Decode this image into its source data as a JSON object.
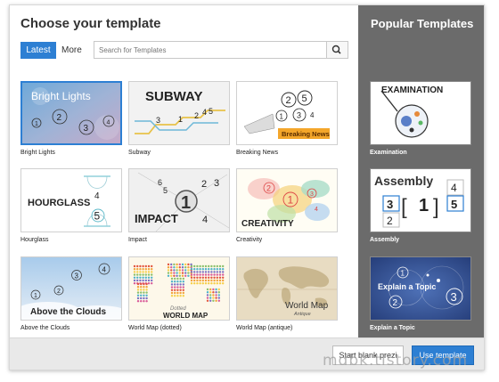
{
  "dialog": {
    "title": "Choose your template",
    "tabs": {
      "latest": "Latest",
      "more": "More"
    },
    "search": {
      "placeholder": "Search for Templates",
      "icon": "search-icon"
    }
  },
  "templates": [
    {
      "caption": "Bright Lights",
      "thumb_text": "Bright Lights",
      "numbers": [
        "1",
        "2",
        "3",
        "4"
      ],
      "selected": true
    },
    {
      "caption": "Subway",
      "thumb_text": "SUBWAY",
      "numbers": [
        "1",
        "2",
        "3",
        "4",
        "5"
      ]
    },
    {
      "caption": "Breaking News",
      "thumb_text": "Breaking News",
      "numbers": [
        "1",
        "2",
        "3",
        "4",
        "5"
      ]
    },
    {
      "caption": "Hourglass",
      "thumb_text": "HOURGLASS",
      "numbers": [
        "4",
        "5"
      ]
    },
    {
      "caption": "Impact",
      "thumb_text": "IMPACT",
      "numbers": [
        "1",
        "2",
        "3",
        "4",
        "5",
        "6"
      ]
    },
    {
      "caption": "Creativity",
      "thumb_text": "CREATIVITY",
      "numbers": [
        "1",
        "2",
        "3",
        "4"
      ]
    },
    {
      "caption": "Above the Clouds",
      "thumb_text": "Above the Clouds",
      "numbers": [
        "1",
        "2",
        "3",
        "4"
      ]
    },
    {
      "caption": "World Map (dotted)",
      "thumb_text": "WORLD MAP",
      "thumb_subtext": "Dotted"
    },
    {
      "caption": "World Map (antique)",
      "thumb_text": "World Map",
      "thumb_subtext": "Antique"
    }
  ],
  "sidebar": {
    "title": "Popular Templates",
    "items": [
      {
        "caption": "Examination",
        "thumb_text": "EXAMINATION"
      },
      {
        "caption": "Assembly",
        "thumb_text": "Assembly",
        "numbers": [
          "1",
          "2",
          "3",
          "4",
          "5"
        ]
      },
      {
        "caption": "Explain a Topic",
        "thumb_text": "Explain a Topic",
        "numbers": [
          "1",
          "2",
          "3"
        ]
      }
    ]
  },
  "footer": {
    "start_blank": "Start blank prezi",
    "use_template": "Use template"
  },
  "watermark": "mdbk.tistory.com",
  "colors": {
    "accent": "#2d7fd3",
    "sidebar_bg": "#6b6b6b",
    "footer_bg": "#e9e9e9"
  }
}
